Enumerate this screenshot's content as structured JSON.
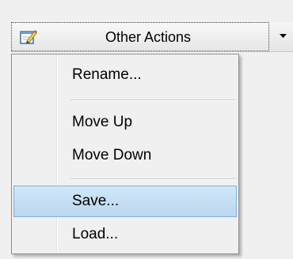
{
  "split_button": {
    "label": "Other Actions",
    "icon": "edit-note-icon",
    "arrow_icon": "dropdown-arrow-icon"
  },
  "menu": {
    "items": [
      {
        "label": "Rename..."
      },
      {
        "label": "Move Up"
      },
      {
        "label": "Move Down"
      },
      {
        "label": "Save...",
        "selected": true
      },
      {
        "label": "Load..."
      }
    ],
    "selection_color": "#bad7f0",
    "selection_border": "#7fafd8"
  }
}
